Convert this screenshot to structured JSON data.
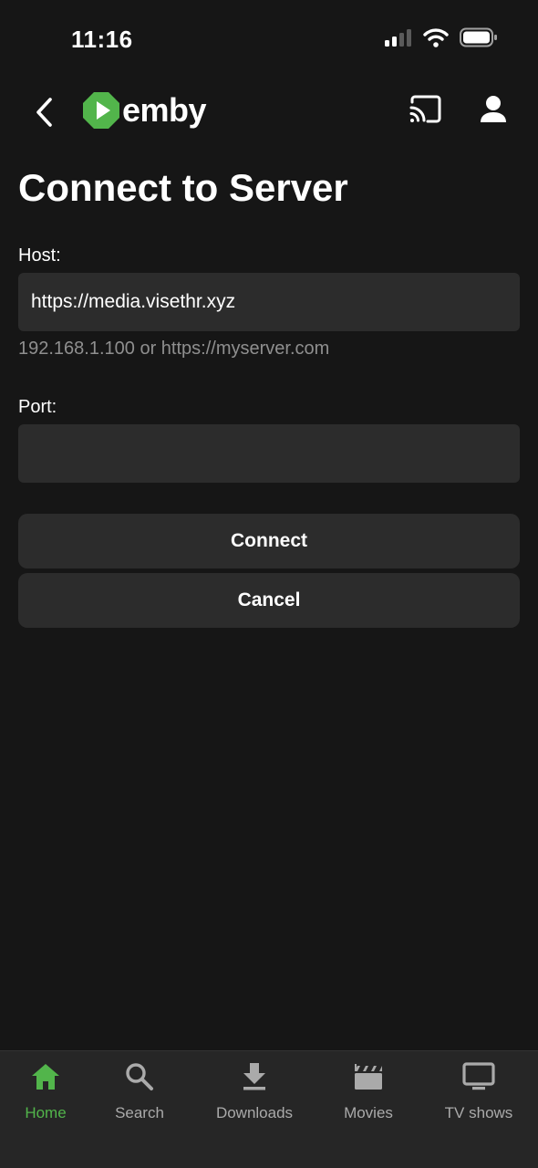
{
  "status_bar": {
    "time": "11:16"
  },
  "header": {
    "logo_text": "emby"
  },
  "page": {
    "title": "Connect to Server"
  },
  "form": {
    "host": {
      "label": "Host:",
      "value": "https://media.visethr.xyz",
      "hint": "192.168.1.100 or https://myserver.com"
    },
    "port": {
      "label": "Port:",
      "value": ""
    }
  },
  "buttons": {
    "connect": "Connect",
    "cancel": "Cancel"
  },
  "bottom_nav": {
    "items": [
      {
        "label": "Home",
        "icon": "home-icon",
        "active": true
      },
      {
        "label": "Search",
        "icon": "search-icon",
        "active": false
      },
      {
        "label": "Downloads",
        "icon": "download-icon",
        "active": false
      },
      {
        "label": "Movies",
        "icon": "clapperboard-icon",
        "active": false
      },
      {
        "label": "TV shows",
        "icon": "tv-icon",
        "active": false
      }
    ]
  },
  "colors": {
    "accent": "#52b54b",
    "background": "#161616",
    "surface": "#2c2c2c",
    "nav_background": "#262626"
  }
}
